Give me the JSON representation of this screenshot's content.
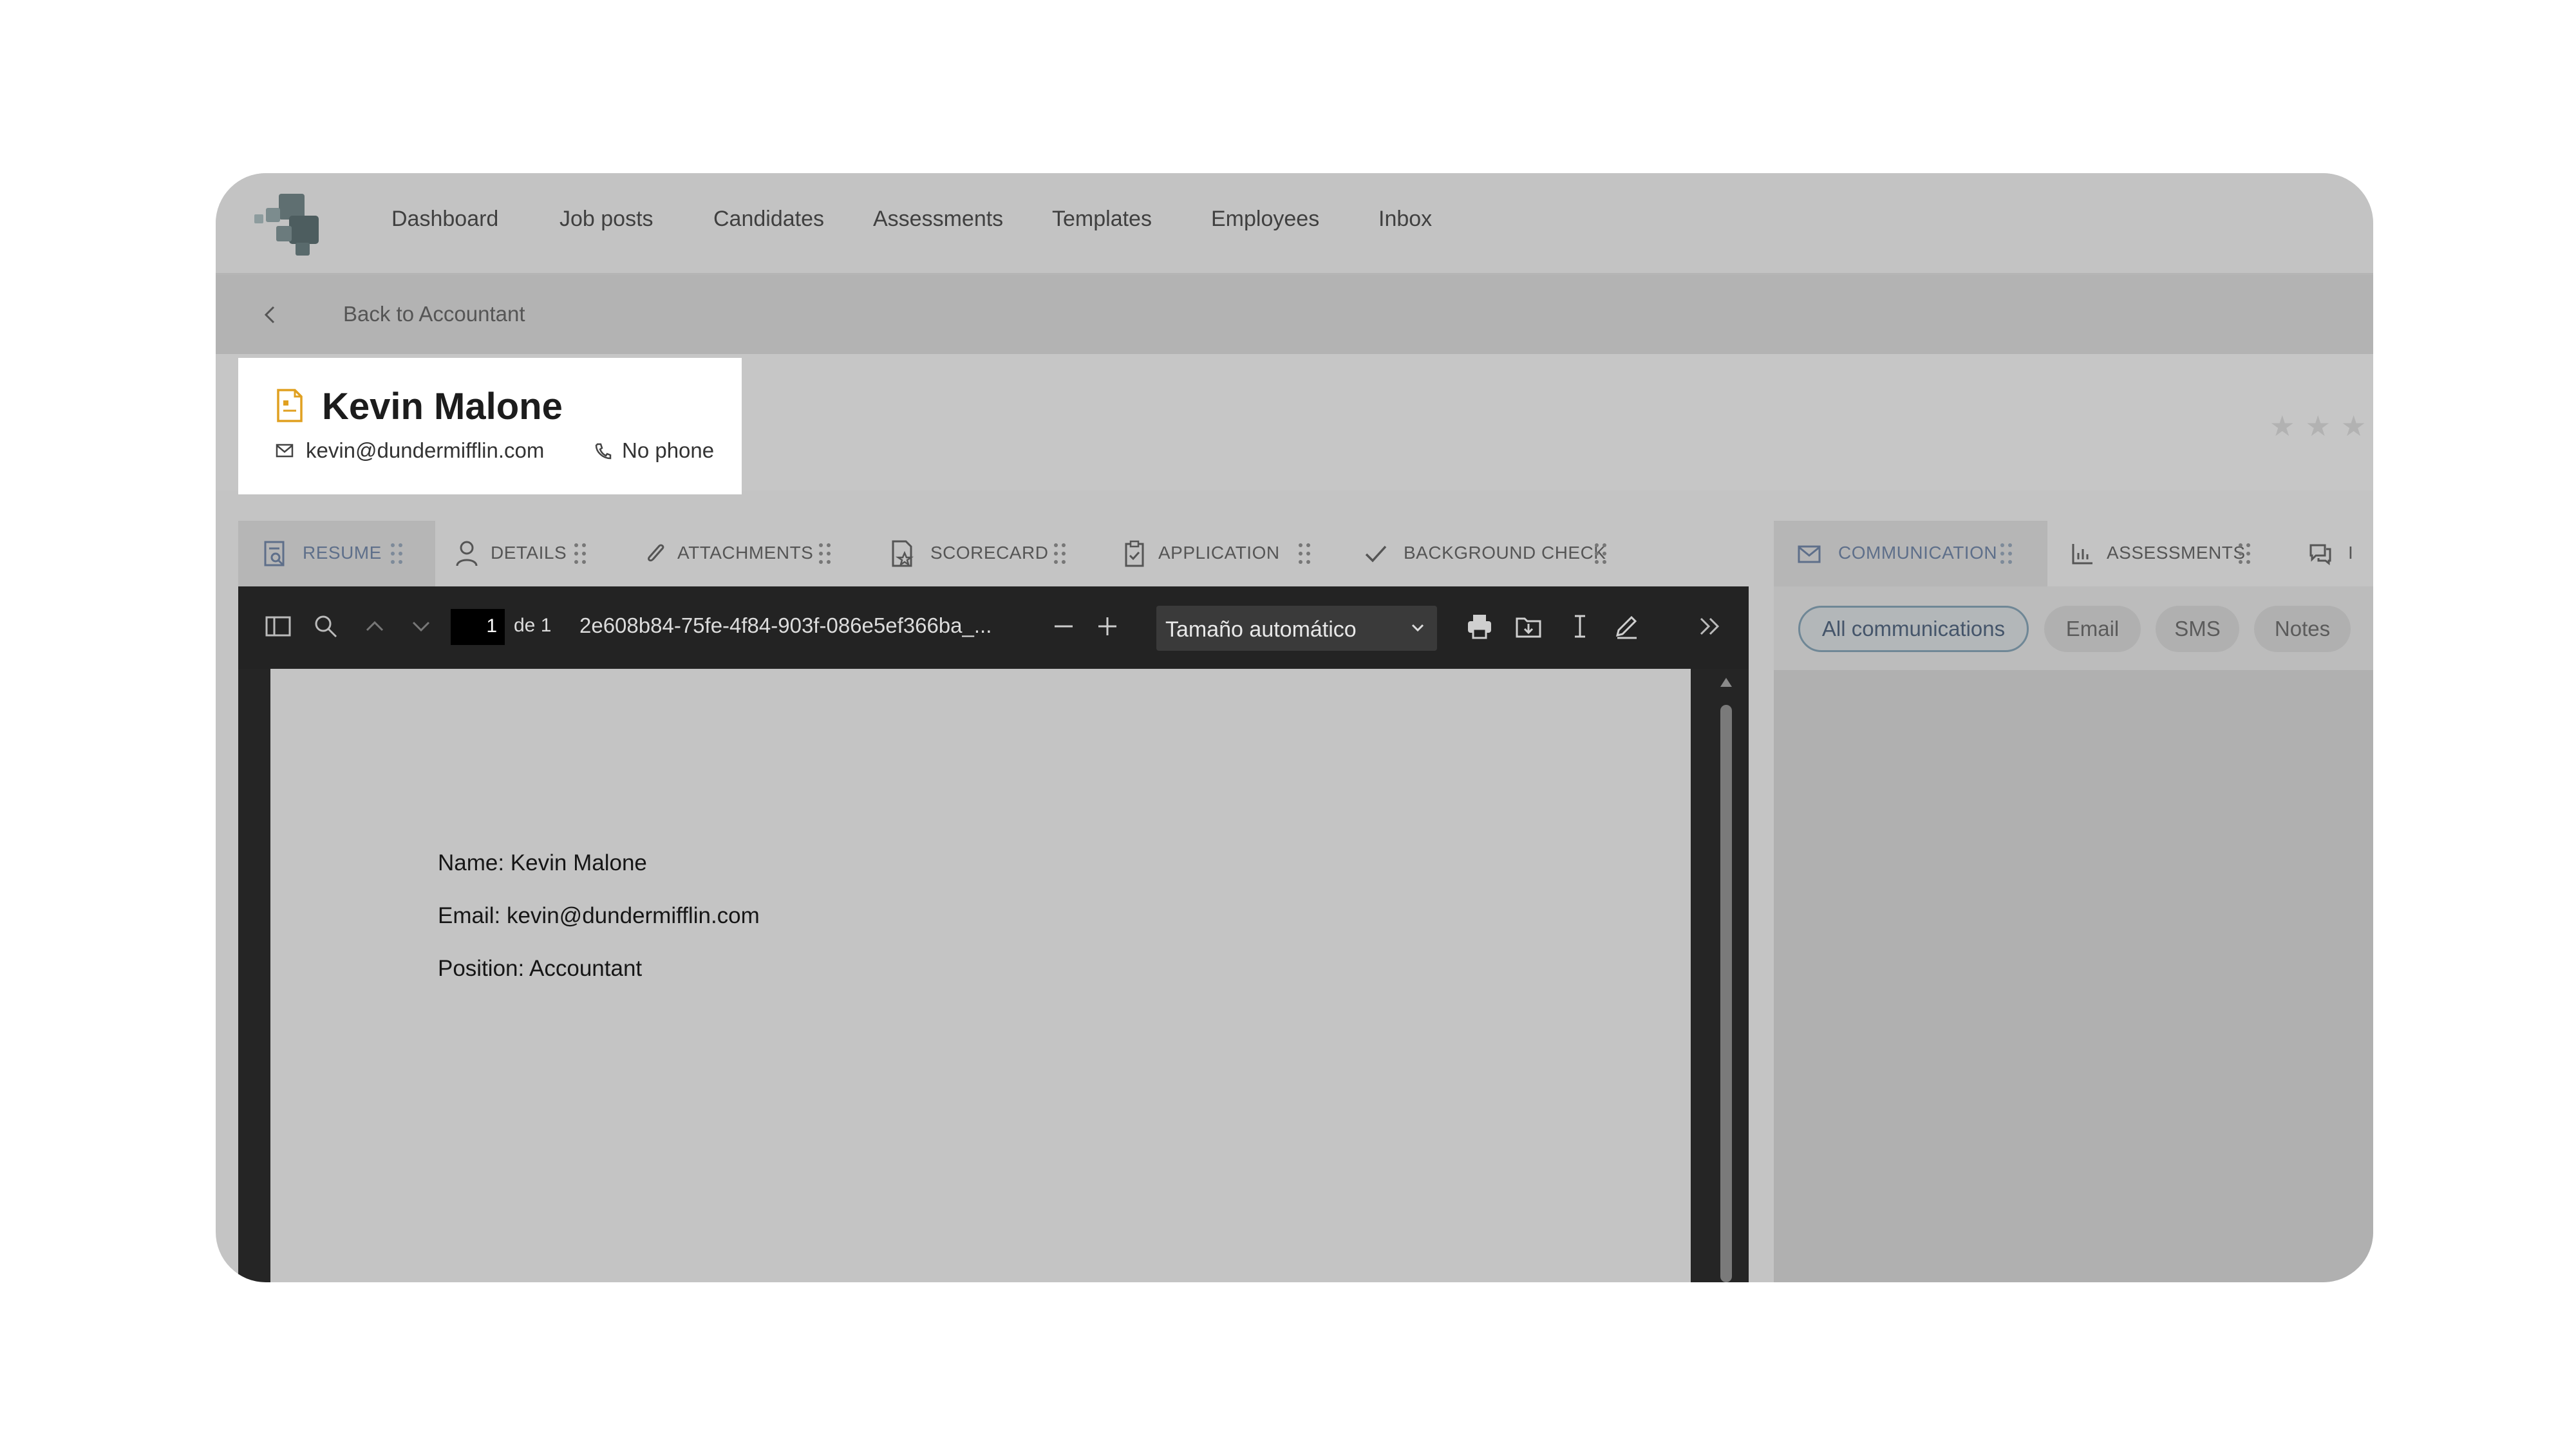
{
  "nav": {
    "items": [
      {
        "label": "Dashboard"
      },
      {
        "label": "Job posts"
      },
      {
        "label": "Candidates"
      },
      {
        "label": "Assessments"
      },
      {
        "label": "Templates"
      },
      {
        "label": "Employees"
      },
      {
        "label": "Inbox"
      }
    ]
  },
  "back": {
    "label": "Back to Accountant"
  },
  "candidate": {
    "name": "Kevin Malone",
    "email": "kevin@dundermifflin.com",
    "phone": "No phone",
    "rating_stars_visible": 3
  },
  "left_tabs": [
    {
      "label": "RESUME",
      "icon": "resume-icon",
      "active": true
    },
    {
      "label": "DETAILS",
      "icon": "person-icon",
      "active": false
    },
    {
      "label": "ATTACHMENTS",
      "icon": "paperclip-icon",
      "active": false
    },
    {
      "label": "SCORECARD",
      "icon": "scorecard-icon",
      "active": false
    },
    {
      "label": "APPLICATION",
      "icon": "clipboard-icon",
      "active": false
    },
    {
      "label": "BACKGROUND CHECK",
      "icon": "check-icon",
      "active": false
    }
  ],
  "pdf_viewer": {
    "page_number": "1",
    "page_of": "de 1",
    "filename": "2e608b84-75fe-4f84-903f-086e5ef366ba_...",
    "zoom": "Tamaño automático",
    "lines": [
      "Name: Kevin Malone",
      "Email: kevin@dundermifflin.com",
      "Position: Accountant"
    ]
  },
  "right_tabs": [
    {
      "label": "COMMUNICATION",
      "icon": "mail-icon",
      "active": true
    },
    {
      "label": "ASSESSMENTS",
      "icon": "bar-chart-icon",
      "active": false
    },
    {
      "label": "I",
      "icon": "chat-icon",
      "active": false
    }
  ],
  "filters": [
    {
      "label": "All communications",
      "active": true
    },
    {
      "label": "Email",
      "active": false
    },
    {
      "label": "SMS",
      "active": false
    },
    {
      "label": "Notes",
      "active": false
    }
  ],
  "colors": {
    "page_background": "#ffffff",
    "overlay_gray": "#c4c4c4",
    "pdf_toolbar": "#232323",
    "candidate_icon": "#e0a020",
    "active_tab_text": "#5e6f8a"
  }
}
